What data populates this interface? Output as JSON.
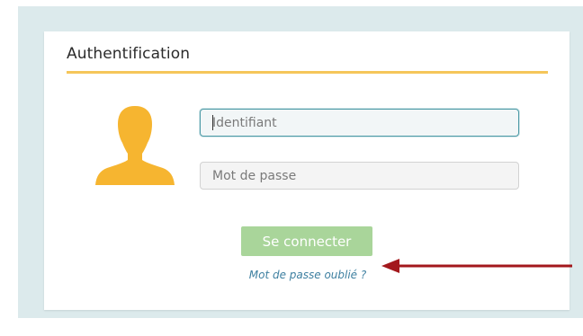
{
  "login": {
    "title": "Authentification",
    "username": {
      "placeholder": "Identifiant",
      "value": ""
    },
    "password": {
      "placeholder": "Mot de passe",
      "value": ""
    },
    "submit_label": "Se connecter",
    "forgot_password_label": "Mot de passe oublié ?"
  },
  "icons": {
    "avatar": "user-silhouette-icon",
    "arrow": "arrow-left-icon"
  },
  "colors": {
    "outer_background": "#dceaec",
    "title_rule": "#f5c65a",
    "avatar": "#f6b530",
    "button": "#a9d59a",
    "link": "#3d7fa0",
    "focus_border": "#4c9aa6",
    "arrow": "#a3181c"
  }
}
